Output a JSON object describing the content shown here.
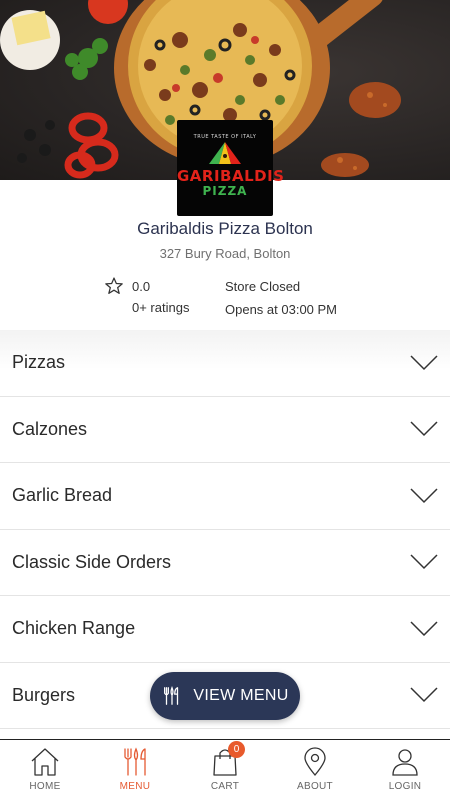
{
  "store": {
    "logo_tagline": "TRUE TASTE OF ITALY",
    "logo_name": "GARIBALDIS",
    "logo_sub": "PIZZA",
    "name": "Garibaldis Pizza Bolton",
    "address": "327 Bury Road, Bolton",
    "rating": "0.0",
    "rating_count": "0+ ratings",
    "status": "Store Closed",
    "opens": "Opens at 03:00 PM"
  },
  "categories": [
    {
      "label": "Pizzas"
    },
    {
      "label": "Calzones"
    },
    {
      "label": "Garlic Bread"
    },
    {
      "label": "Classic Side Orders"
    },
    {
      "label": "Chicken Range"
    },
    {
      "label": "Burgers"
    }
  ],
  "view_menu": {
    "label": "VIEW MENU",
    "icon": "cutlery-icon"
  },
  "nav": {
    "items": [
      {
        "label": "HOME",
        "icon": "home-icon"
      },
      {
        "label": "MENU",
        "icon": "cutlery-icon",
        "active": true
      },
      {
        "label": "CART",
        "icon": "shopping-bag-icon",
        "badge": "0"
      },
      {
        "label": "ABOUT",
        "icon": "location-pin-icon"
      },
      {
        "label": "LOGIN",
        "icon": "user-icon"
      }
    ]
  },
  "colors": {
    "accent": "#e55a32",
    "button": "#2b3757",
    "title": "#2c3350"
  }
}
